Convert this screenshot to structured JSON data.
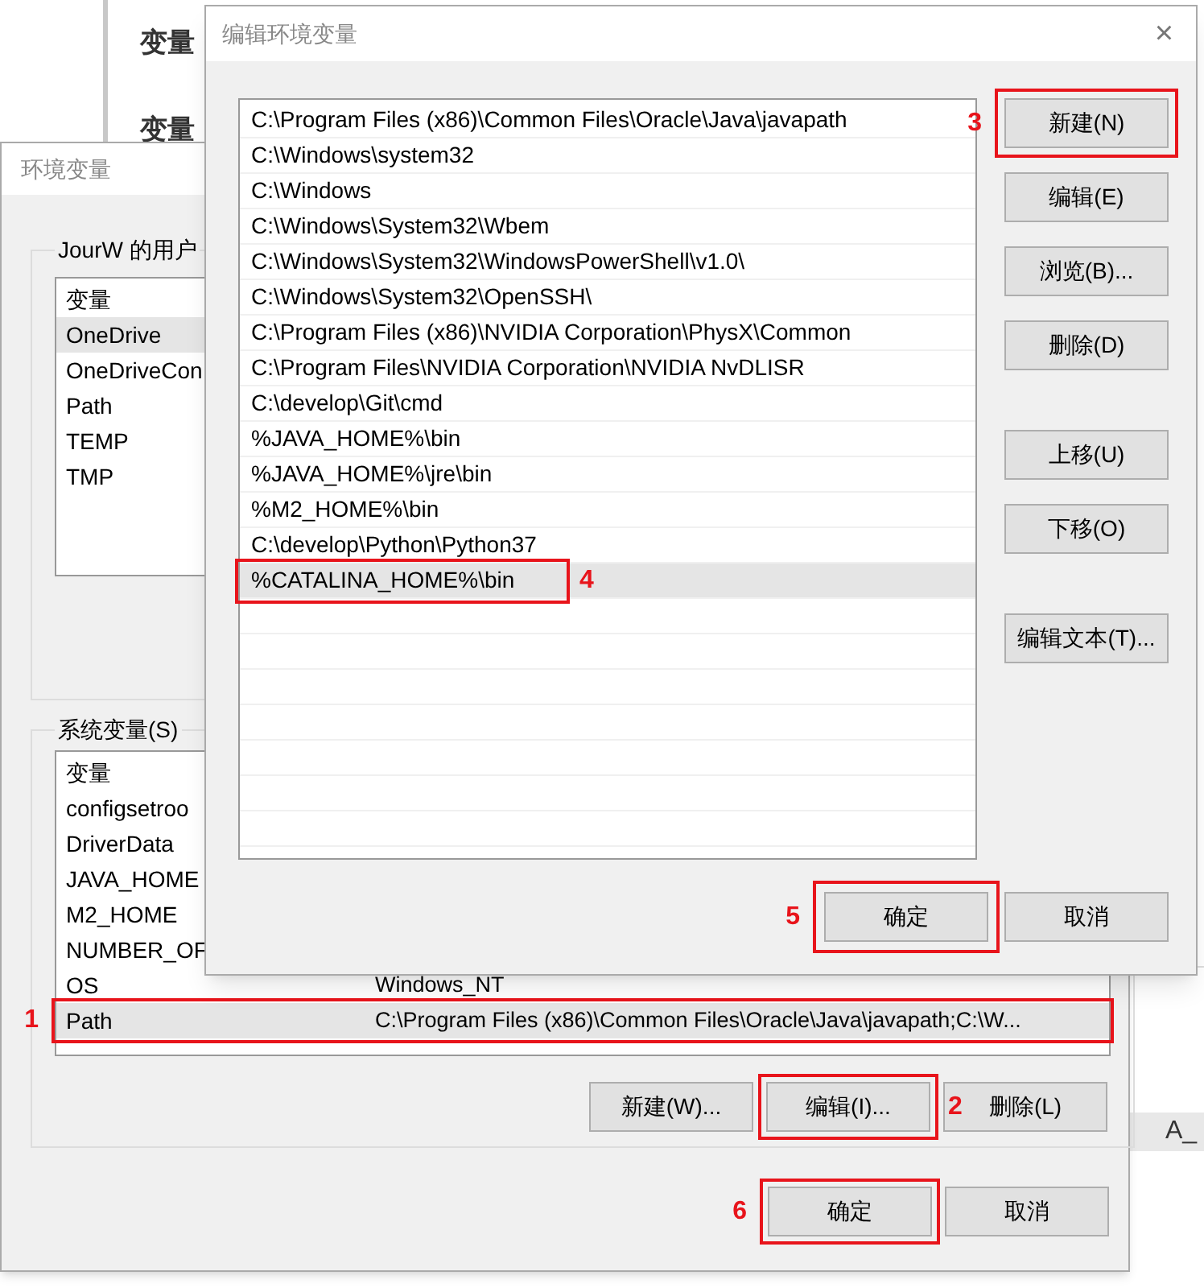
{
  "back_window": {
    "labels": [
      "变量",
      "变量"
    ],
    "right_fragment": "A_"
  },
  "env_window": {
    "title": "环境变量",
    "user_group": {
      "label": "JourW 的用户",
      "header": "变量",
      "items": [
        {
          "name": "OneDrive",
          "selected": true
        },
        {
          "name": "OneDriveCon",
          "selected": false
        },
        {
          "name": "Path",
          "selected": false
        },
        {
          "name": "TEMP",
          "selected": false
        },
        {
          "name": "TMP",
          "selected": false
        }
      ]
    },
    "system_group": {
      "label": "系统变量(S)",
      "header": "变量",
      "rows": [
        {
          "name": "configsetroo",
          "selected": false
        },
        {
          "name": "DriverData",
          "selected": false
        },
        {
          "name": "JAVA_HOME",
          "selected": false
        },
        {
          "name": "M2_HOME",
          "selected": false
        },
        {
          "name": "NUMBER_OF",
          "selected": false
        },
        {
          "name": "OS",
          "value": "Windows_NT",
          "selected": false
        },
        {
          "name": "Path",
          "value": "C:\\Program Files (x86)\\Common Files\\Oracle\\Java\\javapath;C:\\W...",
          "selected": true,
          "annotation": "1"
        }
      ],
      "buttons": [
        {
          "label": "新建(W)..."
        },
        {
          "label": "编辑(I)...",
          "annotation": "2"
        },
        {
          "label": "删除(L)"
        }
      ]
    },
    "buttons": [
      {
        "label": "确定",
        "annotation": "6"
      },
      {
        "label": "取消"
      }
    ]
  },
  "edit_dialog": {
    "title": "编辑环境变量",
    "close": "×",
    "items": [
      {
        "text": "C:\\Program Files (x86)\\Common Files\\Oracle\\Java\\javapath",
        "selected": false
      },
      {
        "text": "C:\\Windows\\system32",
        "selected": false
      },
      {
        "text": "C:\\Windows",
        "selected": false
      },
      {
        "text": "C:\\Windows\\System32\\Wbem",
        "selected": false
      },
      {
        "text": "C:\\Windows\\System32\\WindowsPowerShell\\v1.0\\",
        "selected": false
      },
      {
        "text": "C:\\Windows\\System32\\OpenSSH\\",
        "selected": false
      },
      {
        "text": "C:\\Program Files (x86)\\NVIDIA Corporation\\PhysX\\Common",
        "selected": false
      },
      {
        "text": "C:\\Program Files\\NVIDIA Corporation\\NVIDIA NvDLISR",
        "selected": false
      },
      {
        "text": "C:\\develop\\Git\\cmd",
        "selected": false
      },
      {
        "text": "%JAVA_HOME%\\bin",
        "selected": false
      },
      {
        "text": "%JAVA_HOME%\\jre\\bin",
        "selected": false
      },
      {
        "text": "%M2_HOME%\\bin",
        "selected": false
      },
      {
        "text": "C:\\develop\\Python\\Python37",
        "selected": false
      },
      {
        "text": "%CATALINA_HOME%\\bin",
        "selected": true,
        "annotation": "4"
      }
    ],
    "side_button_groups": [
      [
        {
          "label": "新建(N)",
          "annotation": "3"
        },
        {
          "label": "编辑(E)"
        },
        {
          "label": "浏览(B)..."
        },
        {
          "label": "删除(D)"
        }
      ],
      [
        {
          "label": "上移(U)"
        },
        {
          "label": "下移(O)"
        }
      ],
      [
        {
          "label": "编辑文本(T)..."
        }
      ]
    ],
    "buttons": [
      {
        "label": "确定",
        "annotation": "5"
      },
      {
        "label": "取消"
      }
    ]
  }
}
